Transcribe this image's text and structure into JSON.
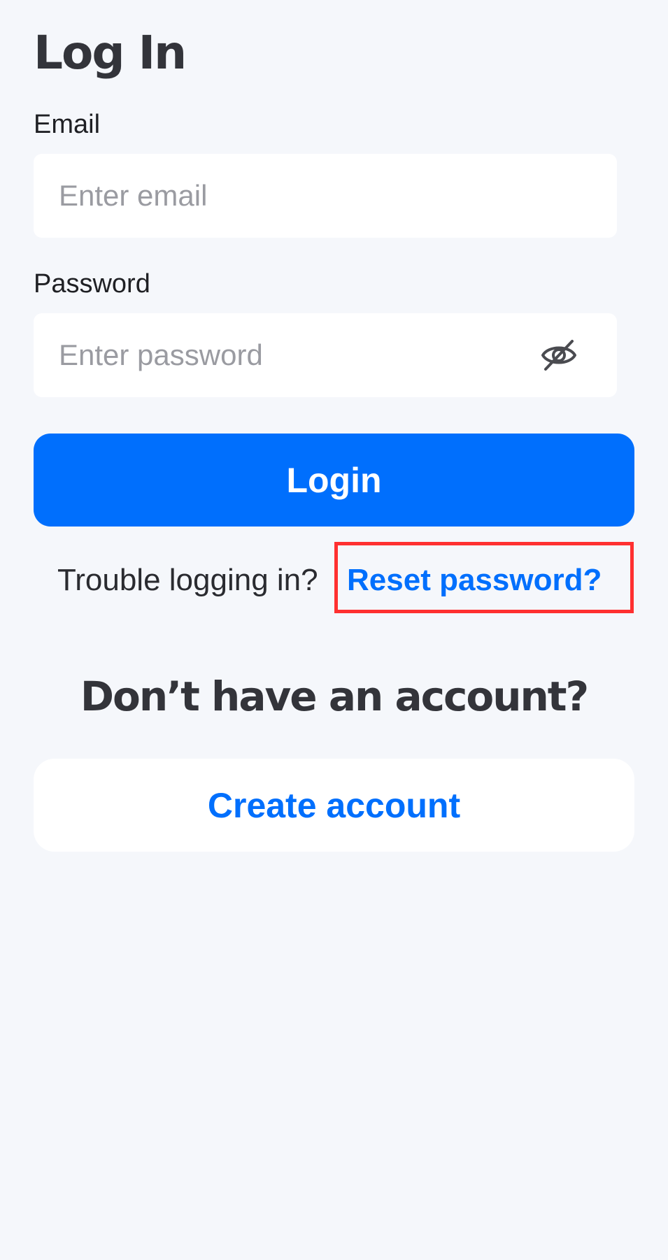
{
  "header": {
    "title": "Log In"
  },
  "form": {
    "email": {
      "label": "Email",
      "value": "",
      "placeholder": "Enter email"
    },
    "password": {
      "label": "Password",
      "value": "",
      "placeholder": "Enter password",
      "visibility_icon": "eye-off-icon"
    },
    "login_label": "Login"
  },
  "help": {
    "prompt": "Trouble logging in?",
    "reset_label": "Reset password?"
  },
  "signup": {
    "heading": "Don’t have an account?",
    "create_label": "Create account"
  },
  "colors": {
    "primary": "#006ffd",
    "background": "#f5f7fb",
    "text_dark": "#33343a",
    "highlight": "#ff3030"
  }
}
